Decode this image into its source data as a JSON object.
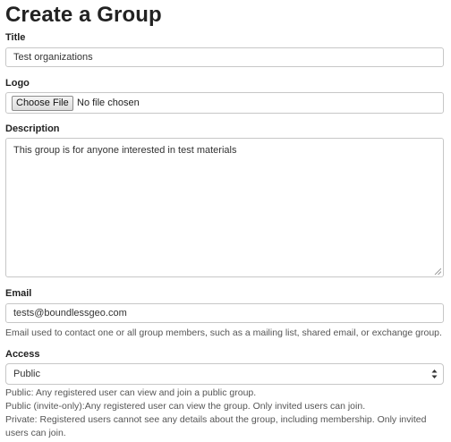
{
  "page": {
    "title": "Create a Group"
  },
  "title_field": {
    "label": "Title",
    "value": "Test organizations"
  },
  "logo_field": {
    "label": "Logo",
    "button_label": "Choose File",
    "status": "No file chosen"
  },
  "description_field": {
    "label": "Description",
    "value": "This group is for anyone interested in test materials"
  },
  "email_field": {
    "label": "Email",
    "value": "tests@boundlessgeo.com",
    "help": "Email used to contact one or all group members, such as a mailing list, shared email, or exchange group."
  },
  "access_field": {
    "label": "Access",
    "selected": "Public",
    "help": [
      "Public: Any registered user can view and join a public group.",
      "Public (invite-only):Any registered user can view the group. Only invited users can join.",
      "Private: Registered users cannot see any details about the group, including membership. Only invited users can join."
    ]
  },
  "icons": {
    "select_arrows": "up-down-chevron-icon",
    "resize_grip": "resize-grip-icon"
  }
}
